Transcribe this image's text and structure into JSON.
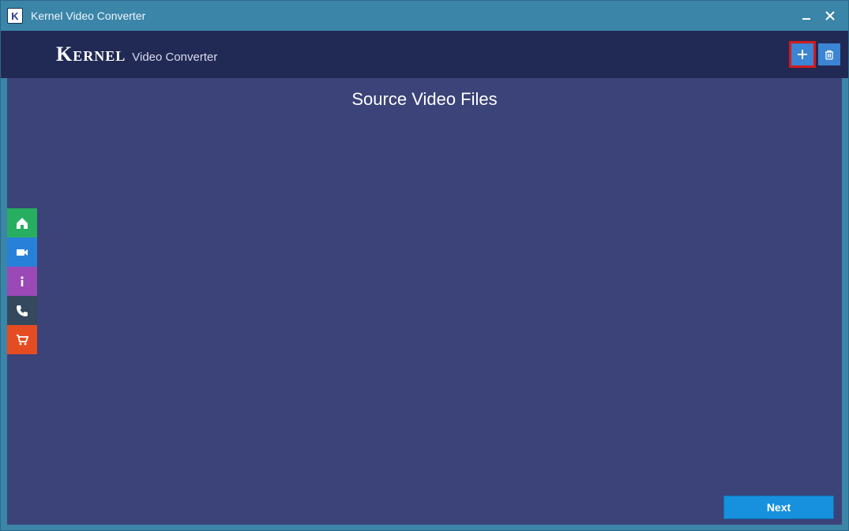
{
  "window": {
    "title": "Kernel Video Converter"
  },
  "header": {
    "brand_main": "Kernel",
    "brand_sub": "Video Converter",
    "actions": {
      "add_label": "add",
      "delete_label": "delete"
    }
  },
  "main": {
    "title": "Source Video Files"
  },
  "sidebar": {
    "items": [
      {
        "name": "home",
        "color": "green"
      },
      {
        "name": "video",
        "color": "blue"
      },
      {
        "name": "info",
        "color": "purple"
      },
      {
        "name": "contact",
        "color": "dark"
      },
      {
        "name": "buy",
        "color": "orange"
      }
    ]
  },
  "footer": {
    "next_label": "Next"
  },
  "colors": {
    "titlebar": "#3b85a9",
    "header": "#212a54",
    "main_bg": "#3b4379",
    "accent": "#1790de",
    "highlight": "#d21b1b"
  }
}
